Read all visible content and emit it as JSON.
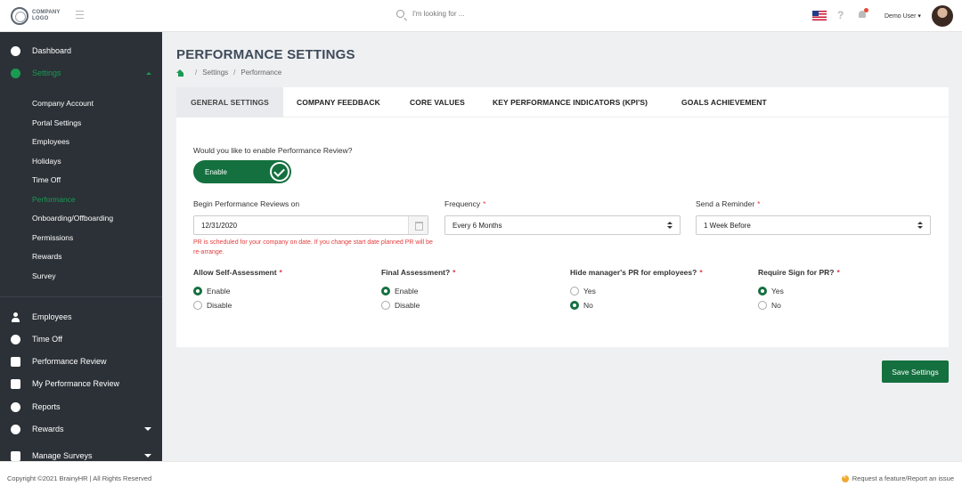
{
  "header": {
    "logo_text_line1": "COMPANY",
    "logo_text_line2": "LOGO",
    "search_placeholder": "I'm looking for ...",
    "help_symbol": "?",
    "user_name": "Demo User"
  },
  "sidebar": {
    "items": [
      {
        "label": "Dashboard",
        "icon": "dashboard-icon"
      },
      {
        "label": "Settings",
        "icon": "gear-icon",
        "active": true
      }
    ],
    "settings_sub": [
      {
        "label": "Company Account"
      },
      {
        "label": "Portal Settings"
      },
      {
        "label": "Employees"
      },
      {
        "label": "Holidays"
      },
      {
        "label": "Time Off"
      },
      {
        "label": "Performance",
        "active": true
      },
      {
        "label": "Onboarding/Offboarding"
      },
      {
        "label": "Permissions"
      },
      {
        "label": "Rewards"
      },
      {
        "label": "Survey"
      }
    ],
    "lower_items": [
      {
        "label": "Employees",
        "icon": "person-icon"
      },
      {
        "label": "Time Off",
        "icon": "clock-icon"
      },
      {
        "label": "Performance Review",
        "icon": "id-card-icon"
      },
      {
        "label": "My Performance Review",
        "icon": "badge-icon"
      },
      {
        "label": "Reports",
        "icon": "pie-chart-icon"
      },
      {
        "label": "Rewards",
        "icon": "award-icon"
      },
      {
        "label": "Manage Surveys",
        "icon": "survey-icon"
      }
    ]
  },
  "page": {
    "title": "PERFORMANCE SETTINGS",
    "breadcrumb": [
      "Settings",
      "Performance"
    ],
    "breadcrumb_sep": "/"
  },
  "tabs": [
    {
      "label": "GENERAL SETTINGS",
      "active": true
    },
    {
      "label": "COMPANY FEEDBACK"
    },
    {
      "label": "CORE VALUES"
    },
    {
      "label": "KEY PERFORMANCE INDICATORS (KPI'S)"
    },
    {
      "label": "GOALS ACHIEVEMENT"
    }
  ],
  "form": {
    "enable_question": "Would you like to enable Performance Review?",
    "toggle_label": "Enable",
    "toggle_on": true,
    "begin_label": "Begin Performance Reviews on",
    "begin_value": "12/31/2020",
    "frequency_label": "Frequency",
    "frequency_value": "Every 6 Months",
    "reminder_label": "Send a Reminder",
    "reminder_value": "1 Week Before",
    "required_mark": "*",
    "hint": "PR is scheduled for your company on date. If you change start date planned PR will be re-arrange.",
    "questions": [
      {
        "label": "Allow Self-Assessment",
        "options": [
          "Enable",
          "Disable"
        ],
        "selected": 0
      },
      {
        "label": "Final Assessment?",
        "options": [
          "Enable",
          "Disable"
        ],
        "selected": 0
      },
      {
        "label": "Hide manager's PR for employees?",
        "options": [
          "Yes",
          "No"
        ],
        "selected": 1
      },
      {
        "label": "Require Sign for PR?",
        "options": [
          "Yes",
          "No"
        ],
        "selected": 0
      }
    ],
    "save_label": "Save Settings"
  },
  "footer": {
    "copyright": "Copyright ©2021 BrainyHR | All Rights Reserved",
    "request": "Request a feature/Report an issue"
  },
  "colors": {
    "accent_green": "#14703f",
    "active_green": "#1a9a52",
    "sidebar_bg": "#2b3137",
    "required_red": "#e23c3c"
  }
}
